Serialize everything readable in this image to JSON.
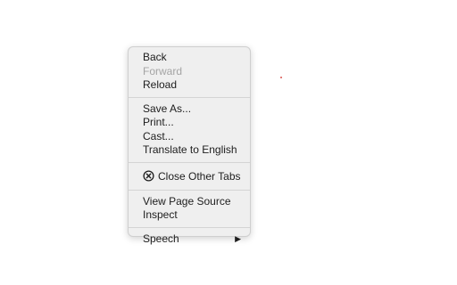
{
  "menu": {
    "group1": {
      "back": "Back",
      "forward": "Forward",
      "reload": "Reload"
    },
    "group2": {
      "save_as": "Save As...",
      "print": "Print...",
      "cast": "Cast...",
      "translate": "Translate to English"
    },
    "group3": {
      "close_other_tabs": "Close Other Tabs",
      "close_icon": "close-circle-icon"
    },
    "group4": {
      "view_page_source": "View Page Source",
      "inspect": "Inspect"
    },
    "group5": {
      "speech": "Speech",
      "submenu_icon": "triangle-right-icon"
    }
  }
}
